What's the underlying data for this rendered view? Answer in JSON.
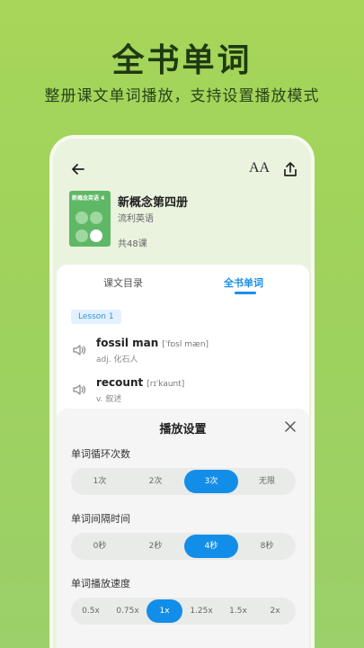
{
  "headline": "全书单词",
  "subheadline": "整册课文单词播放，支持设置播放模式",
  "topbar": {
    "back_icon": "back-arrow-icon",
    "font_icon_text": "AA",
    "share_icon": "share-icon"
  },
  "book": {
    "cover_label": "新概念英语 4",
    "title": "新概念第四册",
    "publisher": "流利英语",
    "lesson_count": "共48课"
  },
  "tabs": [
    {
      "label": "课文目录",
      "selected": false
    },
    {
      "label": "全书单词",
      "selected": true
    }
  ],
  "lesson_tag": "Lesson 1",
  "words": [
    {
      "word": "fossil man",
      "phonetic": "[ˈfɒsl mæn]",
      "meaning": "adj. 化石人"
    },
    {
      "word": "recount",
      "phonetic": "[rɪˈkaunt]",
      "meaning": "v. 叙述"
    }
  ],
  "sheet": {
    "title": "播放设置",
    "loop": {
      "label": "单词循环次数",
      "options": [
        "1次",
        "2次",
        "3次",
        "无限"
      ],
      "selected": "3次"
    },
    "interval": {
      "label": "单词间隔时间",
      "options": [
        "0秒",
        "2秒",
        "4秒",
        "8秒"
      ],
      "selected": "4秒"
    },
    "speed": {
      "label": "单词播放速度",
      "options": [
        "0.5x",
        "0.75x",
        "1x",
        "1.25x",
        "1.5x",
        "2x"
      ],
      "selected": "1x"
    }
  },
  "colors": {
    "accent": "#138ee8",
    "background": "#a6d65a",
    "cover": "#5fb865"
  }
}
